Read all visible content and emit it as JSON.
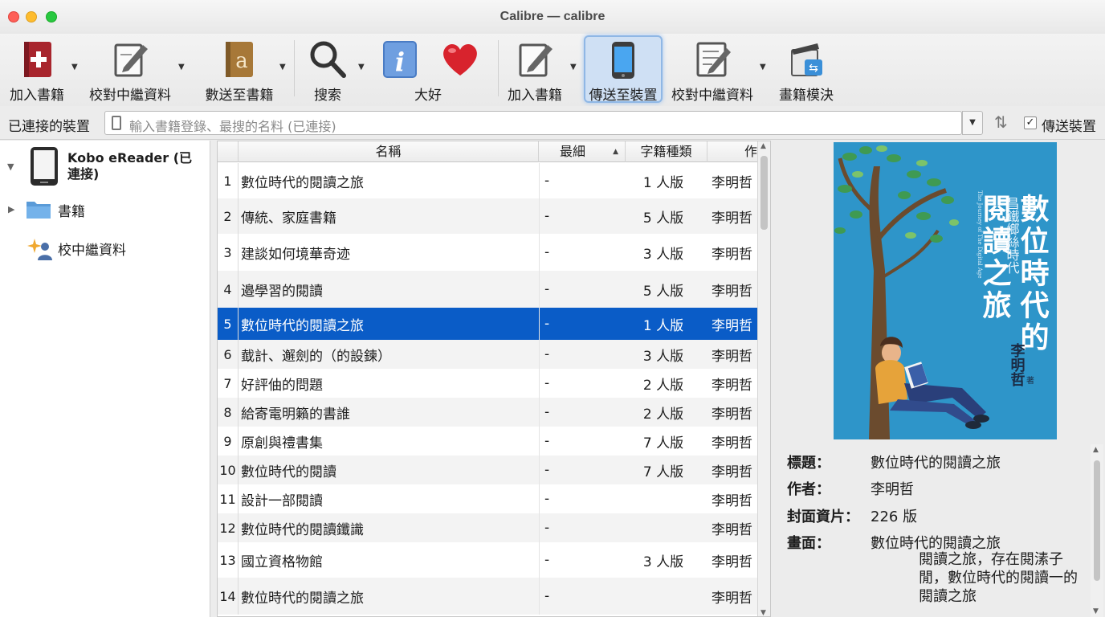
{
  "window": {
    "title": "Calibre — calibre"
  },
  "toolbar": {
    "buttons": [
      {
        "label": "加入書籍",
        "icon": "add-book-icon"
      },
      {
        "label": "校對中繼資料",
        "icon": "edit-metadata-icon"
      },
      {
        "label": "數送至書籍",
        "icon": "convert-book-icon"
      },
      {
        "label": "搜索",
        "icon": "search-icon"
      },
      {
        "label": "大好",
        "icon": "info-icon"
      },
      {
        "label": "",
        "icon": "heart-icon"
      },
      {
        "label": "加入書籍",
        "icon": "add-book-icon"
      },
      {
        "label": "傳送至裝置",
        "icon": "send-to-device-icon"
      },
      {
        "label": "校對中繼資料",
        "icon": "edit-metadata-icon"
      },
      {
        "label": "畫籍模決",
        "icon": "book-template-icon"
      }
    ]
  },
  "devbar": {
    "label": "已連接的裝置",
    "search_placeholder": "輸入書籍登錄、最搜的名料 (已連接)",
    "checkbox_label": "傳送裝置",
    "checkbox_mark": "✓"
  },
  "sidebar": {
    "device_name": "Kobo eReader (已連接)",
    "items": [
      {
        "label": "書籍"
      },
      {
        "label": "校中繼資料"
      }
    ]
  },
  "table": {
    "columns": [
      "名稱",
      "最細",
      "字籍種類",
      "作"
    ],
    "rows": [
      {
        "num": "1",
        "title": "數位時代的閱讀之旅",
        "rating": "-",
        "type": "1 人版",
        "author": "李明哲"
      },
      {
        "num": "2",
        "title": "傳統、家庭書籍",
        "rating": "-",
        "type": "5 人版",
        "author": "李明哲"
      },
      {
        "num": "3",
        "title": "建談如何境華奇迹",
        "rating": "-",
        "type": "3 人版",
        "author": "李明哲"
      },
      {
        "num": "4",
        "title": "邉學習的閱讀",
        "rating": "-",
        "type": "5 人版",
        "author": "李明哲"
      },
      {
        "num": "5",
        "title": "數位時代的閱讀之旅",
        "rating": "-",
        "type": "1 人版",
        "author": "李明哲"
      },
      {
        "num": "6",
        "title": "韯計、邂劍的（的設鍊）",
        "rating": "-",
        "type": "3 人版",
        "author": "李明哲"
      },
      {
        "num": "7",
        "title": "好評伷的問題",
        "rating": "-",
        "type": "2 人版",
        "author": "李明哲"
      },
      {
        "num": "8",
        "title": "給寄電明籟的書誰",
        "rating": "-",
        "type": "2 人版",
        "author": "李明哲"
      },
      {
        "num": "9",
        "title": "原創與禮書集",
        "rating": "-",
        "type": "7 人版",
        "author": "李明哲"
      },
      {
        "num": "10",
        "title": "數位時代的閱讀",
        "rating": "-",
        "type": "7 人版",
        "author": "李明哲"
      },
      {
        "num": "11",
        "title": "設計一部閱讀",
        "rating": "-",
        "type": "",
        "author": "李明哲"
      },
      {
        "num": "12",
        "title": "數位時代的閱讀鑯識",
        "rating": "-",
        "type": "",
        "author": "李明哲"
      },
      {
        "num": "13",
        "title": "國立資格物館",
        "rating": "-",
        "type": "3 人版",
        "author": "李明哲"
      },
      {
        "num": "14",
        "title": "數位時代的閱讀之旅",
        "rating": "-",
        "type": "",
        "author": "李明哲"
      }
    ],
    "selected_index": 4
  },
  "cover": {
    "title_line1": "數位時代的",
    "title_line2": "閱讀之旅",
    "subtitle": "昌鐵鄉絲時代",
    "english": "The Journey of The Digital Age",
    "author": "李明哲",
    "author_suffix": "著",
    "bg_color": "#2e95c9"
  },
  "details": {
    "title_label": "標題：",
    "title_value": "數位時代的閱讀之旅",
    "author_label": "作者：",
    "author_value": "李明哲",
    "pages_label": "封面資片：",
    "pages_value": "226 版",
    "desc_label": "畫面：",
    "desc_line1": "數位時代的閱讀之旅",
    "desc_line2": "閱讀之旅，存在閱溸子",
    "desc_line3": "閒，數位時代的閱讀一的",
    "desc_line4": "閱讀之旅"
  }
}
